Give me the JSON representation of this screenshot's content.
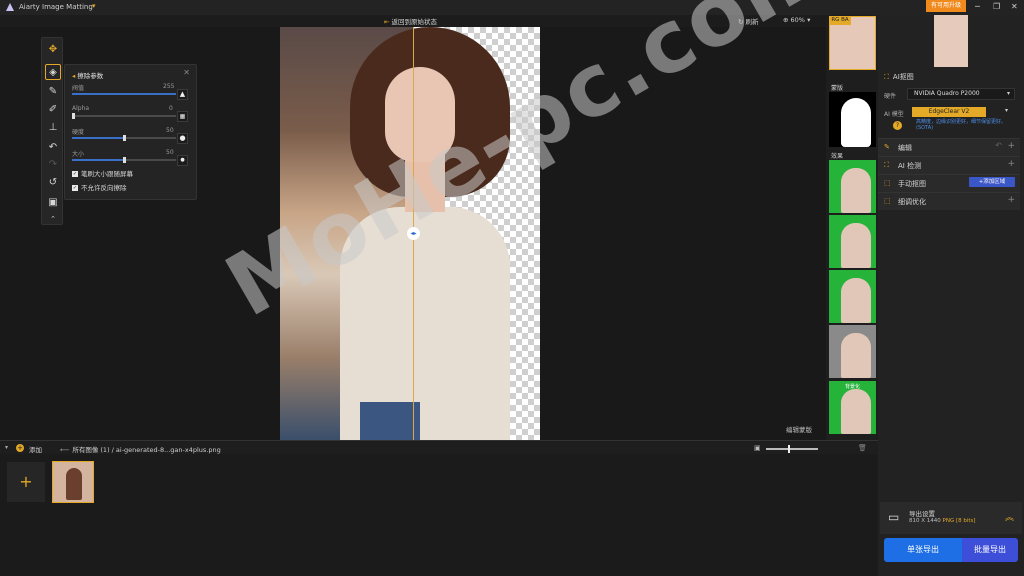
{
  "titlebar": {
    "app_title": "Aiarty Image Matting",
    "upgrade_label": "有可用升级",
    "minimize": "─",
    "restore": "❐",
    "close": "✕"
  },
  "topbar": {
    "back_to_original": "返回到原始状态",
    "refresh_label": "刷新",
    "zoom_value": "60%"
  },
  "params_panel": {
    "title": "擦除参数",
    "params": [
      {
        "label": "阀值",
        "value": "255"
      },
      {
        "label": "Alpha",
        "value": "0"
      },
      {
        "label": "硬度",
        "value": "50"
      },
      {
        "label": "大小",
        "value": "50"
      }
    ],
    "checkbox_1": "笔刷大小跟随屏幕",
    "checkbox_2": "不允许反向擦除"
  },
  "canvas": {
    "edit_mask_label": "编辑蒙版"
  },
  "thumbstrip": {
    "rgba_label": "RG BA",
    "mask_label": "蒙版",
    "effects_label": "效果",
    "effect_labels": [
      "",
      "",
      "",
      "",
      "背景化"
    ]
  },
  "right_panel": {
    "ai_keying_label": "AI抠图",
    "hardware_label": "硬件",
    "hardware_value": "NVIDIA Quadro P2000",
    "model_label": "AI 模型",
    "model_value": "EdgeClear V2",
    "model_desc": "高精度，边缘识别更好，细节保留更好。(SOTA)",
    "sections": [
      {
        "label": "编辑"
      },
      {
        "label": "AI 检测"
      },
      {
        "label": "手动抠图",
        "action": "+添加区域"
      },
      {
        "label": "细调优化"
      }
    ],
    "export_title": "导出设置",
    "export_size": "810 X 1440",
    "export_format": "PNG",
    "export_bits": "[8 bits]",
    "btn_single": "单张导出",
    "btn_batch": "批量导出"
  },
  "bottombar": {
    "add_label": "添加",
    "breadcrumb": "所有图像 (1)  /  ai-generated-8...gan-x4plus.png"
  },
  "watermark": "MoHe-pc.com"
}
